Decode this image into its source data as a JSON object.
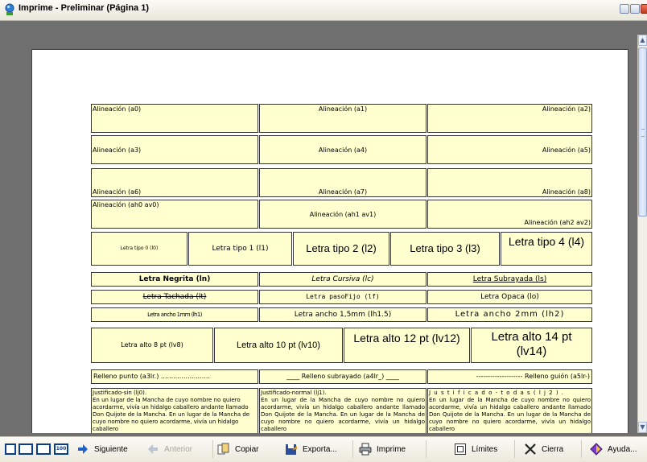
{
  "window": {
    "title": "Imprime - Preliminar (Página 1)"
  },
  "boxes": {
    "a0": "Alineación (a0)",
    "a1": "Alineación (a1)",
    "a2": "Alineación (a2)",
    "a3": "Alineación (a3)",
    "a4": "Alineación (a4)",
    "a5": "Alineación (a5)",
    "a6": "Alineación (a6)",
    "a7": "Alineación (a7)",
    "a8": "Alineación (a8)",
    "ah0": "Alineación (ah0 av0)",
    "ah1": "Alineación (ah1 av1)",
    "ah2": "Alineación (ah2 av2)",
    "l0": "Letra tipo 0 (l0)",
    "l1": "Letra tipo 1 (l1)",
    "l2": "Letra tipo 2 (l2)",
    "l3": "Letra tipo 3 (l3)",
    "l4": "Letra tipo 4 (l4)",
    "ln": "Letra Negrita (ln)",
    "lc": "Letra Cursiva (lc)",
    "ls": "Letra Subrayada (ls)",
    "lt": "Letra Tachada (lt)",
    "lf": "Letra pasoFijo (lf)",
    "lo": "Letra Opaca (lo)",
    "lh1": "Letra ancho 1mm (lh1)",
    "lh15": "Letra ancho 1,5mm (lh1.5)",
    "lh2": "Letra ancho 2mm (lh2)",
    "lv8": "Letra alto 8 pt (lv8)",
    "lv10": "Letra alto 10 pt (lv10)",
    "lv12": "Letra alto 12 pt (lv12)",
    "lv14": "Letra alto 14 pt (lv14)",
    "r3": "Relleno punto (a3lr.) ........................",
    "r4": "____ Relleno subrayado (a4lr_) ____",
    "r5": "-------------------- Relleno guión (a5lr-)"
  },
  "paragraphs": [
    {
      "heading": "Justificado-sin (lj0).",
      "text": "En un lugar de la Mancha de cuyo nombre no quiero acordarme, vivía un hidalgo caballero andante llamado Don Quijote de la Mancha. En un lugar de la Mancha de cuyo nombre no quiero acordarme, vivía un hidalgo caballero"
    },
    {
      "heading": "Justificado-normal (lj1).",
      "text": "En un lugar de la Mancha de cuyo nombre no quiero acordarme, vivía un hidalgo caballero andante llamado Don Quijote de la Mancha. En un lugar de la Mancha de cuyo nombre no quiero acordarme, vivía un hidalgo caballero"
    },
    {
      "heading": "J u s t i f i c a d o - t o d a s  ( l j 2 ) .",
      "text": "En un lugar de la Mancha de cuyo nombre no quiero acordarme, vivía un hidalgo caballero andante llamado Don Quijote de la Mancha. En un lugar de la Mancha de cuyo nombre no quiero acordarme, vivía un hidalgo caballero"
    }
  ],
  "toolbar": {
    "views": [
      "single-page-icon",
      "two-page-icon",
      "fit-page-icon",
      "zoom-100-icon"
    ],
    "zoom100_label": "100",
    "siguiente": "Siguiente",
    "anterior": "Anterior",
    "copiar": "Copiar",
    "exporta": "Exporta...",
    "imprime": "Imprime",
    "limites": "Límites",
    "cierra": "Cierra",
    "ayuda": "Ayuda..."
  },
  "colors": {
    "box_fill": "#ffffd0",
    "workspace": "#6f6f6f",
    "accent": "#0a3e8c"
  }
}
